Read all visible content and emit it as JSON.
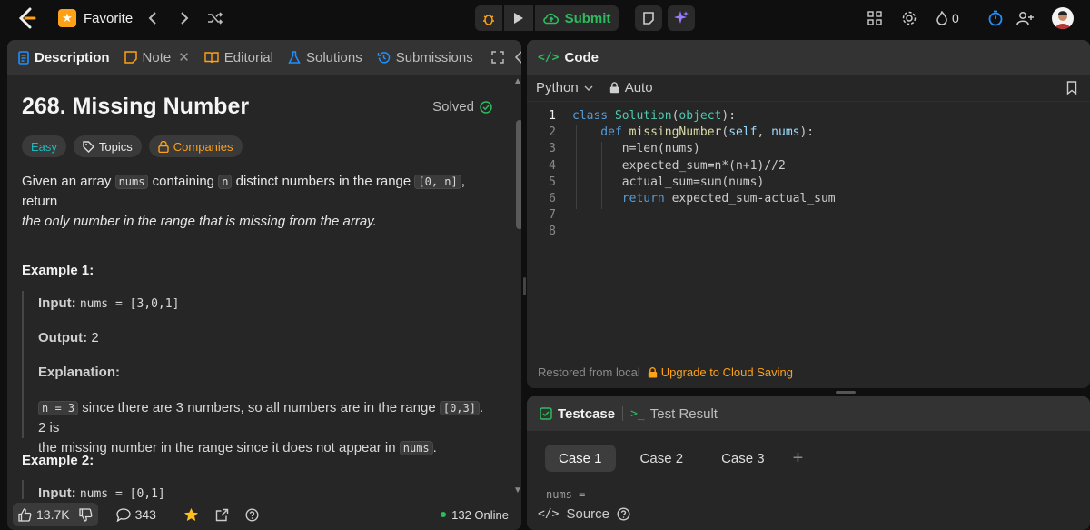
{
  "topbar": {
    "favorite_label": "Favorite",
    "submit_label": "Submit",
    "streak_count": "0"
  },
  "left_tabs": [
    {
      "label": "Description"
    },
    {
      "label": "Note"
    },
    {
      "label": "Editorial"
    },
    {
      "label": "Solutions"
    },
    {
      "label": "Submissions"
    }
  ],
  "problem": {
    "title": "268. Missing Number",
    "status": "Solved",
    "difficulty": "Easy",
    "topics_label": "Topics",
    "companies_label": "Companies",
    "statement_1": "Given an array",
    "statement_code_1": "nums",
    "statement_2": "containing",
    "statement_code_2": "n",
    "statement_3": "distinct numbers in the range",
    "statement_code_3": "[0, n]",
    "statement_4": ", return",
    "statement_italic": "the only number in the range that is missing from the array.",
    "example1_heading": "Example 1:",
    "example1_input_label": "Input:",
    "example1_input": "nums = [3,0,1]",
    "example1_output_label": "Output:",
    "example1_output": "2",
    "example1_expl_label": "Explanation:",
    "example1_expl_code1": "n = 3",
    "example1_expl_text1": "since there are 3 numbers, so all numbers are in the range",
    "example1_expl_code2": "[0,3]",
    "example1_expl_text2": ". 2 is",
    "example1_expl_text3": "the missing number in the range since it does not appear in",
    "example1_expl_code3": "nums",
    "example1_expl_text4": ".",
    "example2_heading": "Example 2:",
    "example2_input_label": "Input:",
    "example2_input": "nums = [0,1]"
  },
  "bottom_bar": {
    "likes": "13.7K",
    "comments": "343",
    "online": "132 Online"
  },
  "code_panel": {
    "title": "Code",
    "language": "Python",
    "mode": "Auto",
    "lines": [
      {
        "n": "1",
        "tokens": [
          {
            "t": "class ",
            "c": "kw"
          },
          {
            "t": "Solution",
            "c": "cls"
          },
          {
            "t": "(",
            "c": ""
          },
          {
            "t": "object",
            "c": "cls"
          },
          {
            "t": "):",
            "c": ""
          }
        ]
      },
      {
        "n": "2",
        "tokens": [
          {
            "t": "    def ",
            "c": "kw"
          },
          {
            "t": "missingNumber",
            "c": "fn"
          },
          {
            "t": "(",
            "c": ""
          },
          {
            "t": "self",
            "c": "param"
          },
          {
            "t": ", ",
            "c": ""
          },
          {
            "t": "nums",
            "c": "param"
          },
          {
            "t": "):",
            "c": ""
          }
        ]
      },
      {
        "n": "3",
        "tokens": [
          {
            "t": "       n=len(nums)",
            "c": ""
          }
        ]
      },
      {
        "n": "4",
        "tokens": [
          {
            "t": "       expected_sum=n*(n+1)//2",
            "c": ""
          }
        ]
      },
      {
        "n": "5",
        "tokens": [
          {
            "t": "       actual_sum=sum(nums)",
            "c": ""
          }
        ]
      },
      {
        "n": "6",
        "tokens": [
          {
            "t": "       ",
            "c": ""
          },
          {
            "t": "return",
            "c": "kw"
          },
          {
            "t": " expected_sum-actual_sum",
            "c": ""
          }
        ]
      },
      {
        "n": "7",
        "tokens": []
      },
      {
        "n": "8",
        "tokens": []
      }
    ],
    "restored_text": "Restored from local",
    "upgrade_text": "Upgrade to Cloud Saving"
  },
  "test_panel": {
    "tab_testcase": "Testcase",
    "tab_result": "Test Result",
    "cases": [
      "Case 1",
      "Case 2",
      "Case 3"
    ],
    "nums_label": "nums =",
    "source_label": "Source"
  },
  "colors": {
    "accent_orange": "#ffa116",
    "submit_green": "#2cbb5d",
    "easy_teal": "#1cbaba",
    "panel_bg": "#262626"
  }
}
